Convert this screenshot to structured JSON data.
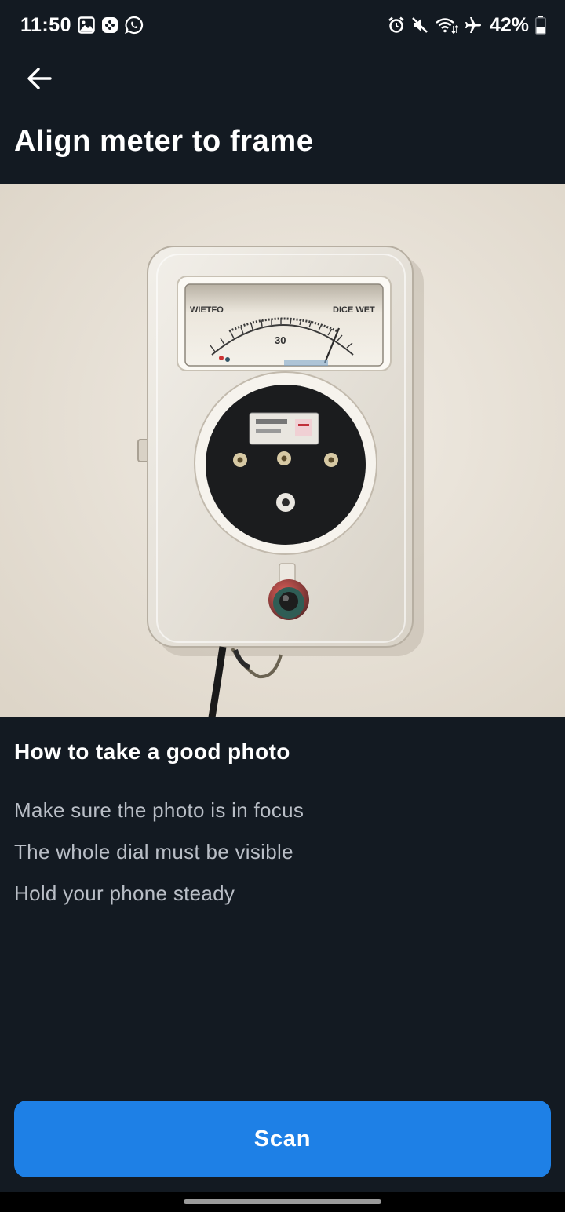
{
  "status_bar": {
    "time": "11:50",
    "battery": "42%",
    "left_icons": [
      "gallery-icon",
      "game-icon",
      "whatsapp-icon"
    ],
    "right_icons": [
      "alarm-icon",
      "mute-icon",
      "wifi-icon",
      "airplane-mode-icon",
      "battery-icon"
    ],
    "battery_level": 0.42
  },
  "header": {
    "back_icon": "arrow-left-icon",
    "title": "Align meter to frame"
  },
  "illustration": {
    "subject": "meter-photo",
    "dial_left_text": "WIETFO",
    "dial_right_text": "DICE WET",
    "dial_reading": "30"
  },
  "tips": {
    "title": "How to take a good photo",
    "items": [
      "Make sure the photo is in focus",
      "The whole dial must be visible",
      "Hold your phone steady"
    ]
  },
  "actions": {
    "scan_label": "Scan"
  },
  "colors": {
    "background": "#131a22",
    "accent": "#1e80e6",
    "text_primary": "#ffffff",
    "text_secondary": "#b9bec6"
  }
}
